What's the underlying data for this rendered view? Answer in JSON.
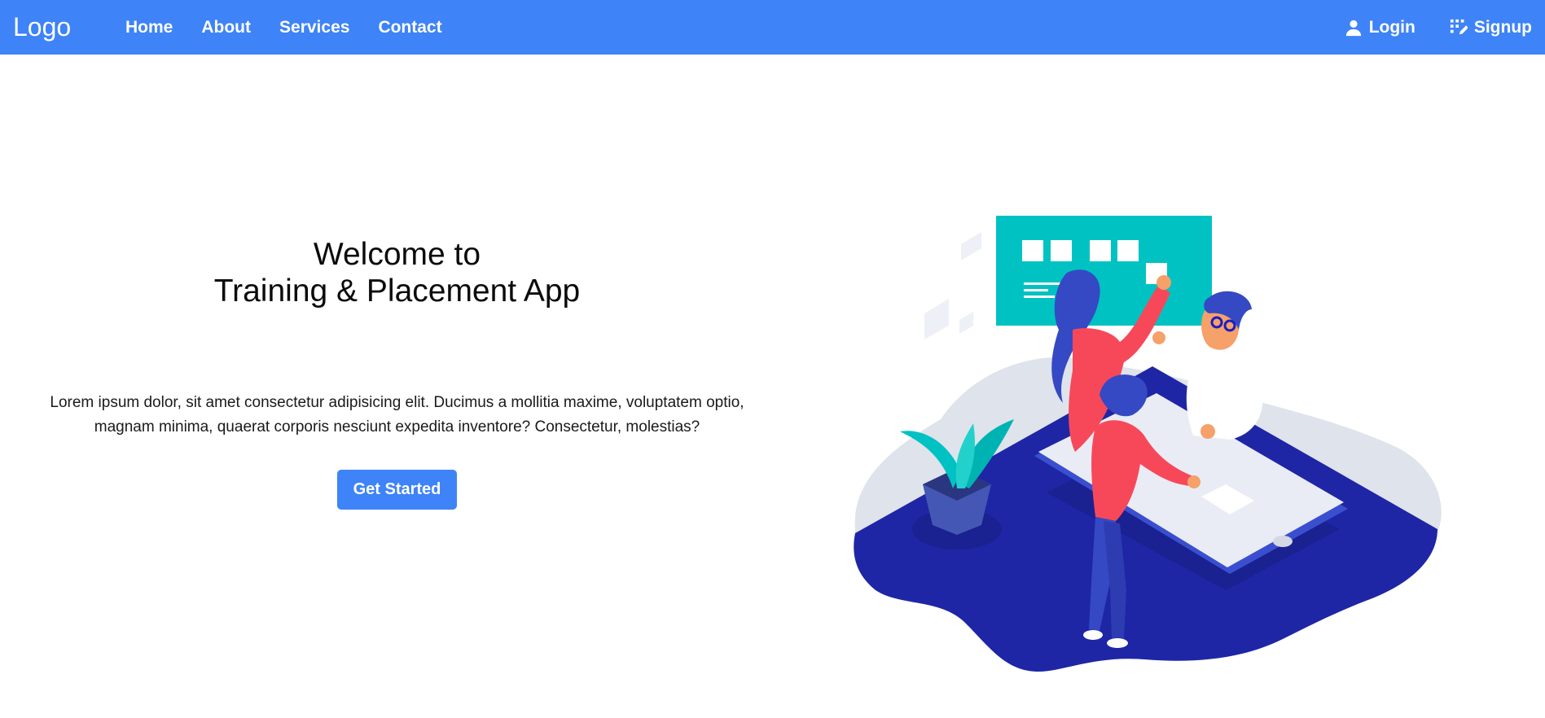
{
  "nav": {
    "logo": "Logo",
    "links": [
      "Home",
      "About",
      "Services",
      "Contact"
    ],
    "login": "Login",
    "signup": "Signup",
    "login_icon": "user-icon",
    "signup_icon": "signup-icon"
  },
  "hero": {
    "title_line1": "Welcome to",
    "title_line2": "Training & Placement App",
    "description": "Lorem ipsum dolor, sit amet consectetur adipisicing elit. Ducimus a mollitia maxime, voluptatem optio, magnam minima, quaerat corporis nesciunt expedita inventore? Consectetur, molestias?",
    "cta": "Get Started"
  },
  "colors": {
    "primary": "#3e83f8",
    "navy": "#1e26a6",
    "teal": "#00c2c2",
    "coral": "#f7485a"
  }
}
